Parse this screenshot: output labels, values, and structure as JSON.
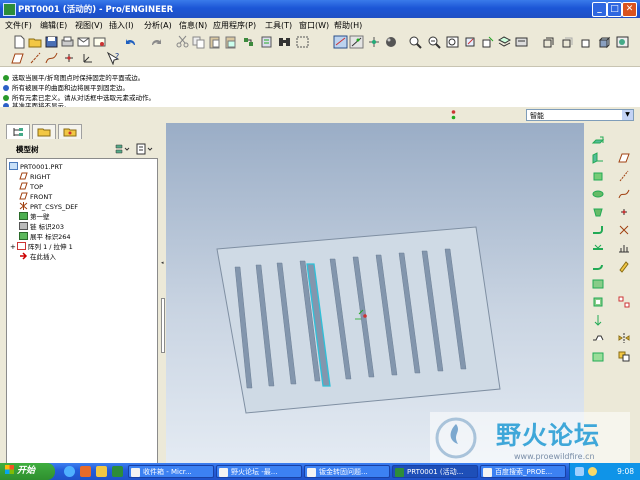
{
  "window": {
    "title": "PRT0001 (活动的) - Pro/ENGINEER",
    "min_label": "_",
    "max_label": "□",
    "close_label": "✕"
  },
  "menubar": {
    "items": [
      {
        "label": "文件(F)"
      },
      {
        "label": "编辑(E)"
      },
      {
        "label": "视图(V)"
      },
      {
        "label": "插入(I)"
      },
      {
        "label": "分析(A)"
      },
      {
        "label": "信息(N)"
      },
      {
        "label": "应用程序(P)"
      },
      {
        "label": "工具(T)"
      },
      {
        "label": "窗口(W)"
      },
      {
        "label": "帮助(H)"
      }
    ]
  },
  "messages": [
    {
      "text": "选取当展平/折弯图点时保持固定的平面或边。",
      "kind": "prompt"
    },
    {
      "text": "所有被展平的曲面和边将展平到固定边。",
      "kind": "info"
    },
    {
      "text": "所有元素已定义。请从对话框中选取元素或动作。",
      "kind": "prompt"
    },
    {
      "text": "基准平面将不显示。",
      "kind": "info"
    }
  ],
  "filter": {
    "selected": "智能",
    "arrow": "▼"
  },
  "model_tree": {
    "header": "模型树",
    "nodes": [
      {
        "label": "PRT0001.PRT",
        "icon": "part-icon"
      },
      {
        "label": "RIGHT",
        "icon": "datum-plane-icon"
      },
      {
        "label": "TOP",
        "icon": "datum-plane-icon"
      },
      {
        "label": "FRONT",
        "icon": "datum-plane-icon"
      },
      {
        "label": "PRT_CSYS_DEF",
        "icon": "csys-icon"
      },
      {
        "label": "第一壁",
        "icon": "first-wall-icon"
      },
      {
        "label": "链 标识203",
        "icon": "chain-icon"
      },
      {
        "label": "展平 标识264",
        "icon": "unbend-icon"
      },
      {
        "label": "阵列 1 / 拉伸 1",
        "icon": "pattern-icon"
      },
      {
        "label": "在此插入",
        "icon": "insert-here-arrow-icon"
      }
    ]
  },
  "taskbar": {
    "start": "开始",
    "tasks": [
      {
        "label": "收件箱 - Micr..."
      },
      {
        "label": "野火论坛 -最..."
      },
      {
        "label": "钣金转固问题..."
      },
      {
        "label": "PRT0001 (活动..."
      },
      {
        "label": "百度搜索_PROE..."
      }
    ],
    "clock": "9:08"
  },
  "watermark": {
    "text": "野火论坛",
    "url": "www.proewildfire.cn"
  },
  "colors": {
    "titlebar": "#1c56d6",
    "viewport_top": "#9aadc6",
    "part_face": "#d2dce6",
    "highlight": "#2fc0d8"
  }
}
